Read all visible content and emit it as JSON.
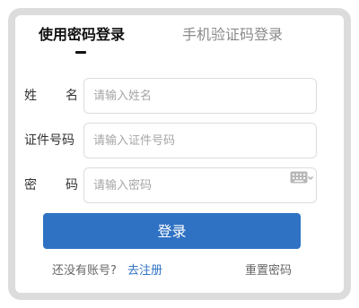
{
  "tabs": {
    "password_login": "使用密码登录",
    "sms_login": "手机验证码登录"
  },
  "fields": {
    "name": {
      "label_chars": [
        "姓",
        "名"
      ],
      "placeholder": "请输入姓名"
    },
    "id_number": {
      "label": "证件号码",
      "placeholder": "请输入证件号码"
    },
    "password": {
      "label_chars": [
        "密",
        "码"
      ],
      "placeholder": "请输入密码"
    }
  },
  "login_button": "登录",
  "footer": {
    "no_account": "还没有账号?",
    "register": "去注册",
    "reset_password": "重置密码"
  },
  "colors": {
    "accent": "#2f72c4",
    "frame_border": "#dcdcdc"
  }
}
